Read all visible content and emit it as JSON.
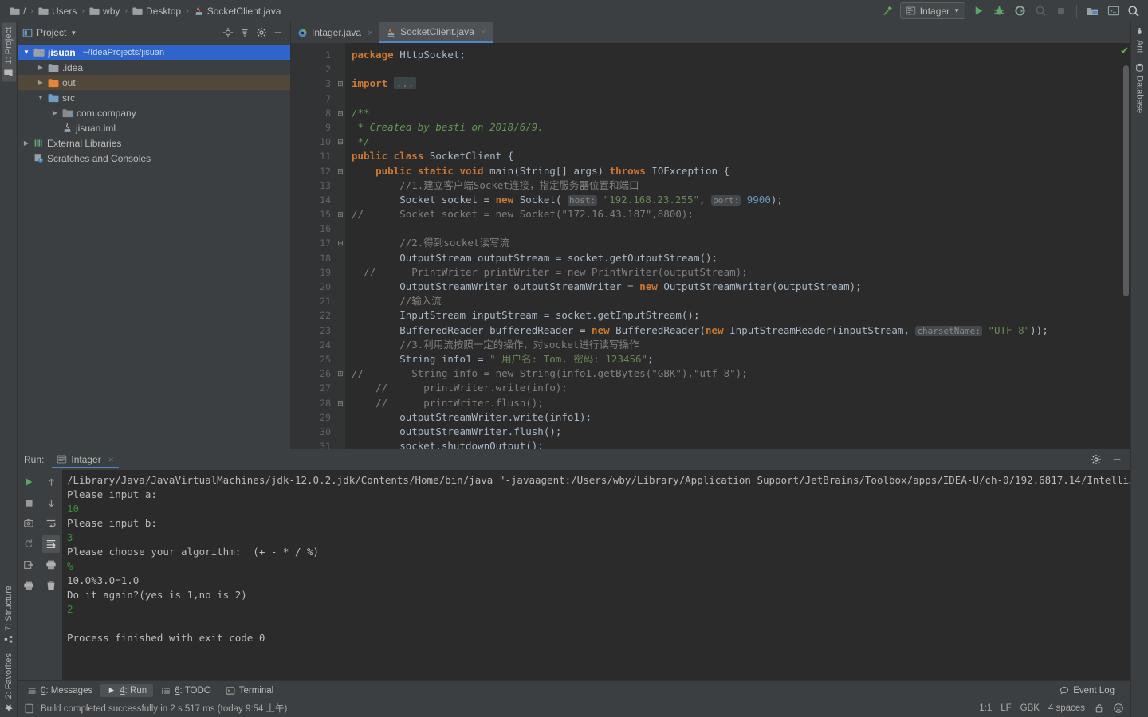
{
  "navbar": {
    "crumbs": [
      {
        "icon": "folder-icon",
        "label": "/"
      },
      {
        "icon": "folder-icon",
        "label": "Users"
      },
      {
        "icon": "folder-icon",
        "label": "wby"
      },
      {
        "icon": "folder-icon",
        "label": "Desktop"
      },
      {
        "icon": "java-file-icon",
        "label": "SocketClient.java"
      }
    ],
    "separator": "›",
    "run_config": "Intager",
    "icons": {
      "update": "build-hammer-icon",
      "run": "run-icon",
      "debug": "debug-icon",
      "run_coverage": "run-with-coverage-icon",
      "profile": "profile-icon",
      "stop": "stop-icon",
      "project_structure": "project-structure-icon",
      "terminal": "terminal-icon",
      "search": "search-everywhere-icon"
    }
  },
  "left_rail": [
    {
      "label": "1: Project",
      "icon": "project-icon",
      "active": true
    },
    {
      "label": "7: Structure",
      "icon": "structure-icon",
      "active": false
    },
    {
      "label": "2: Favorites",
      "icon": "favorites-star-icon",
      "active": false
    }
  ],
  "right_rail": [
    {
      "label": "Ant",
      "icon": "ant-icon"
    },
    {
      "label": "Database",
      "icon": "database-icon"
    }
  ],
  "project_panel": {
    "title": "Project",
    "dropdown": "▾",
    "tools": [
      "locate-icon",
      "collapse-all-icon",
      "settings-gear-icon",
      "hide-icon"
    ],
    "tree": [
      {
        "indent": 0,
        "arrow": "▼",
        "icon": "module-icon",
        "name": "jisuan",
        "path": "~/IdeaProjects/jisuan",
        "state": "selected",
        "bold": true
      },
      {
        "indent": 1,
        "arrow": "▶",
        "icon": "folder-grey",
        "name": ".idea",
        "path": "",
        "state": "",
        "bold": false
      },
      {
        "indent": 1,
        "arrow": "▶",
        "icon": "folder-orange",
        "name": "out",
        "path": "",
        "state": "highlight",
        "bold": false
      },
      {
        "indent": 1,
        "arrow": "▼",
        "icon": "folder-blue",
        "name": "src",
        "path": "",
        "state": "",
        "bold": false
      },
      {
        "indent": 2,
        "arrow": "▶",
        "icon": "package-icon",
        "name": "com.company",
        "path": "",
        "state": "",
        "bold": false
      },
      {
        "indent": 2,
        "arrow": "",
        "icon": "iml-file-icon",
        "name": "jisuan.iml",
        "path": "",
        "state": "",
        "bold": false
      },
      {
        "indent": 0,
        "arrow": "▶",
        "icon": "libraries-icon",
        "name": "External Libraries",
        "path": "",
        "state": "",
        "bold": false
      },
      {
        "indent": 0,
        "arrow": "",
        "icon": "scratches-icon",
        "name": "Scratches and Consoles",
        "path": "",
        "state": "",
        "bold": false
      }
    ]
  },
  "editor": {
    "tabs": [
      {
        "label": "Intager.java",
        "icon": "class-icon",
        "active": false,
        "close": "×"
      },
      {
        "label": "SocketClient.java",
        "icon": "java-file-icon",
        "active": true,
        "close": "×"
      }
    ],
    "line_numbers": [
      1,
      2,
      3,
      7,
      8,
      9,
      10,
      11,
      12,
      13,
      14,
      15,
      16,
      17,
      18,
      19,
      20,
      21,
      22,
      23,
      24,
      25,
      26,
      27,
      28,
      29,
      30,
      31
    ],
    "inspection_status": "ok-check-icon",
    "lines": [
      {
        "n": 1,
        "fold": "",
        "tokens": [
          {
            "t": "package ",
            "c": "kw"
          },
          {
            "t": "HttpSocket",
            "c": ""
          },
          {
            "t": ";",
            "c": ""
          }
        ]
      },
      {
        "n": 2,
        "fold": "",
        "tokens": []
      },
      {
        "n": 3,
        "fold": "+",
        "tokens": [
          {
            "t": "import ",
            "c": "kw"
          },
          {
            "t": "...",
            "c": "imports"
          }
        ]
      },
      {
        "n": 7,
        "fold": "",
        "tokens": []
      },
      {
        "n": 8,
        "fold": "-",
        "tokens": [
          {
            "t": "/**",
            "c": "doc"
          }
        ]
      },
      {
        "n": 9,
        "fold": "",
        "tokens": [
          {
            "t": " * Created by besti on 2018/6/9.",
            "c": "doc"
          }
        ]
      },
      {
        "n": 10,
        "fold": "-",
        "tokens": [
          {
            "t": " */",
            "c": "doc"
          }
        ]
      },
      {
        "n": 11,
        "fold": "",
        "tokens": [
          {
            "t": "public class ",
            "c": "kw"
          },
          {
            "t": "SocketClient ",
            "c": ""
          },
          {
            "t": "{",
            "c": ""
          }
        ]
      },
      {
        "n": 12,
        "fold": "-",
        "tokens": [
          {
            "t": "    public static void ",
            "c": "kw"
          },
          {
            "t": "main(String[] args) ",
            "c": ""
          },
          {
            "t": "throws ",
            "c": "kw"
          },
          {
            "t": "IOException {",
            "c": ""
          }
        ]
      },
      {
        "n": 13,
        "fold": "",
        "tokens": [
          {
            "t": "        //1.建立客户端Socket连接，指定服务器位置和端口",
            "c": "cmt"
          }
        ]
      },
      {
        "n": 14,
        "fold": "",
        "tokens": [
          {
            "t": "        Socket socket = ",
            "c": ""
          },
          {
            "t": "new ",
            "c": "kw"
          },
          {
            "t": "Socket( ",
            "c": ""
          },
          {
            "t": "host:",
            "c": "hint"
          },
          {
            "t": " ",
            "c": ""
          },
          {
            "t": "\"192.168.23.255\"",
            "c": "str"
          },
          {
            "t": ", ",
            "c": ""
          },
          {
            "t": "port:",
            "c": "hint"
          },
          {
            "t": " ",
            "c": ""
          },
          {
            "t": "9900",
            "c": "num"
          },
          {
            "t": ");",
            "c": ""
          }
        ]
      },
      {
        "n": 15,
        "fold": "+",
        "tokens": [
          {
            "t": "//      Socket socket = new Socket(\"172.16.43.187\",8800);",
            "c": "cmt"
          }
        ]
      },
      {
        "n": 16,
        "fold": "",
        "tokens": []
      },
      {
        "n": 17,
        "fold": "-",
        "tokens": [
          {
            "t": "        //2.得到socket读写流",
            "c": "cmt"
          }
        ]
      },
      {
        "n": 18,
        "fold": "",
        "tokens": [
          {
            "t": "        OutputStream outputStream = socket.getOutputStream();",
            "c": ""
          }
        ]
      },
      {
        "n": 19,
        "fold": "",
        "tokens": [
          {
            "t": "  //      PrintWriter printWriter = new PrintWriter(outputStream);",
            "c": "cmt"
          }
        ]
      },
      {
        "n": 20,
        "fold": "",
        "tokens": [
          {
            "t": "        OutputStreamWriter outputStreamWriter = ",
            "c": ""
          },
          {
            "t": "new ",
            "c": "kw"
          },
          {
            "t": "OutputStreamWriter(outputStream);",
            "c": ""
          }
        ]
      },
      {
        "n": 21,
        "fold": "",
        "tokens": [
          {
            "t": "        //输入流",
            "c": "cmt"
          }
        ]
      },
      {
        "n": 22,
        "fold": "",
        "tokens": [
          {
            "t": "        InputStream inputStream = socket.getInputStream();",
            "c": ""
          }
        ]
      },
      {
        "n": 23,
        "fold": "",
        "tokens": [
          {
            "t": "        BufferedReader bufferedReader = ",
            "c": ""
          },
          {
            "t": "new ",
            "c": "kw"
          },
          {
            "t": "BufferedReader(",
            "c": ""
          },
          {
            "t": "new ",
            "c": "kw"
          },
          {
            "t": "InputStreamReader(inputStream, ",
            "c": ""
          },
          {
            "t": "charsetName:",
            "c": "hint"
          },
          {
            "t": " ",
            "c": ""
          },
          {
            "t": "\"UTF-8\"",
            "c": "str"
          },
          {
            "t": "));",
            "c": ""
          }
        ]
      },
      {
        "n": 24,
        "fold": "",
        "tokens": [
          {
            "t": "        //3.利用流按照一定的操作，对socket进行读写操作",
            "c": "cmt"
          }
        ]
      },
      {
        "n": 25,
        "fold": "",
        "tokens": [
          {
            "t": "        String info1 = ",
            "c": ""
          },
          {
            "t": "\" 用户名: Tom, 密码: 123456\"",
            "c": "str"
          },
          {
            "t": ";",
            "c": ""
          }
        ]
      },
      {
        "n": 26,
        "fold": "+",
        "tokens": [
          {
            "t": "//        String info = new String(info1.getBytes(\"GBK\"),\"utf-8\");",
            "c": "cmt"
          }
        ]
      },
      {
        "n": 27,
        "fold": "",
        "tokens": [
          {
            "t": "    //      printWriter.write(info);",
            "c": "cmt"
          }
        ]
      },
      {
        "n": 28,
        "fold": "-",
        "tokens": [
          {
            "t": "    //      printWriter.flush();",
            "c": "cmt"
          }
        ]
      },
      {
        "n": 29,
        "fold": "",
        "tokens": [
          {
            "t": "        outputStreamWriter.write(info1);",
            "c": ""
          }
        ]
      },
      {
        "n": 30,
        "fold": "",
        "tokens": [
          {
            "t": "        outputStreamWriter.flush();",
            "c": ""
          }
        ]
      },
      {
        "n": 31,
        "fold": "",
        "tokens": [
          {
            "t": "        socket.shutdownOutput();",
            "c": ""
          }
        ]
      }
    ]
  },
  "run_panel": {
    "label": "Run:",
    "tab": "Intager",
    "tab_close": "×",
    "header_icons": [
      "settings-gear-icon",
      "hide-icon"
    ],
    "tools_left": [
      "rerun-icon",
      "stop-icon",
      "dump-threads-icon",
      "restore-layout-icon",
      "export-icon",
      "print-icon"
    ],
    "tools_right": [
      "up-stack-icon",
      "down-stack-icon",
      "soft-wrap-icon",
      "scroll-to-end-icon",
      "print-icon",
      "clear-all-icon"
    ],
    "console": [
      {
        "type": "out",
        "text": "/Library/Java/JavaVirtualMachines/jdk-12.0.2.jdk/Contents/Home/bin/java \"-javaagent:/Users/wby/Library/Application Support/JetBrains/Toolbox/apps/IDEA-U/ch-0/192.6817.14/IntelliJ IDEA.app/Co"
      },
      {
        "type": "out",
        "text": "Please input a:"
      },
      {
        "type": "in",
        "text": "10"
      },
      {
        "type": "out",
        "text": "Please input b:"
      },
      {
        "type": "in",
        "text": "3"
      },
      {
        "type": "out",
        "text": "Please choose your algorithm:  (+ - * / %)"
      },
      {
        "type": "in",
        "text": "%"
      },
      {
        "type": "out",
        "text": "10.0%3.0=1.0"
      },
      {
        "type": "out",
        "text": "Do it again?(yes is 1,no is 2)"
      },
      {
        "type": "in",
        "text": "2"
      },
      {
        "type": "out",
        "text": ""
      },
      {
        "type": "out",
        "text": "Process finished with exit code 0"
      }
    ]
  },
  "bottom_bar": {
    "items": [
      {
        "num": "0",
        "label": ": Messages",
        "icon": "messages-icon",
        "active": false
      },
      {
        "num": "4",
        "label": ": Run",
        "icon": "run-icon",
        "active": true
      },
      {
        "num": "6",
        "label": ": TODO",
        "icon": "todo-icon",
        "active": false
      },
      {
        "num": "",
        "label": "Terminal",
        "icon": "terminal-icon",
        "active": false
      }
    ],
    "event_log": "Event Log",
    "event_log_icon": "event-log-icon"
  },
  "status_bar": {
    "message": "Build completed successfully in 2 s 517 ms (today 9:54 上午)",
    "message_icon": "build-status-icon",
    "caret": "1:1",
    "line_sep": "LF",
    "encoding": "GBK",
    "indent": "4 spaces",
    "lock_icon": "unlock-icon",
    "inspection_icon": "inspection-face-icon"
  },
  "colors": {
    "accent": "#4a88c7",
    "selection": "#2f65ca",
    "green": "#62b543",
    "orange": "#cc7832",
    "string": "#6a8759",
    "panel": "#3c3f41",
    "editor_bg": "#2b2b2b"
  }
}
